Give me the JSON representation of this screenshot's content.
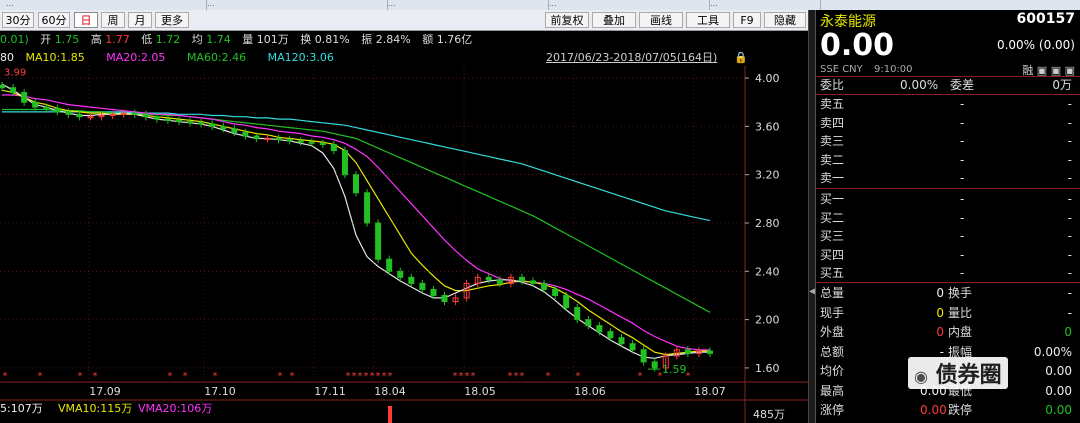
{
  "tabs": [
    "...",
    "...",
    "...",
    "...",
    "..."
  ],
  "toolbar": {
    "periods": [
      {
        "label": "30分",
        "active": false
      },
      {
        "label": "60分",
        "active": false
      },
      {
        "label": "日",
        "active": true
      },
      {
        "label": "周",
        "active": false
      },
      {
        "label": "月",
        "active": false
      },
      {
        "label": "更多",
        "active": false
      }
    ],
    "tools": [
      "前复权",
      "叠加",
      "画线",
      "工具",
      "F9",
      "隐藏"
    ]
  },
  "info": {
    "change": "0.01)",
    "open_label": "开",
    "open": "1.75",
    "high_label": "高",
    "high": "1.77",
    "low_label": "低",
    "low": "1.72",
    "avg_label": "均",
    "avg": "1.74",
    "volume_label": "量",
    "volume": "101万",
    "turnover_label": "换",
    "turnover": "0.81%",
    "amplitude_label": "振",
    "amplitude": "2.84%",
    "amount_label": "额",
    "amount": "1.76亿"
  },
  "ma": {
    "ma5": "80",
    "ma10": "MA10:1.85",
    "ma20": "MA20:2.05",
    "ma60": "MA60:2.46",
    "ma120": "MA120:3.06",
    "date_range": "2017/06/23-2018/07/05(164日)"
  },
  "chart_data": {
    "type": "candlestick",
    "y_ticks": [
      "4.00",
      "3.60",
      "3.20",
      "2.80",
      "2.40",
      "2.00",
      "1.60"
    ],
    "x_ticks": [
      "17.09",
      "17.10",
      "17.11",
      "18.04",
      "18.05",
      "18.06",
      "18.07"
    ],
    "annotations": [
      "3.99",
      "1.59"
    ],
    "closes": [
      3.92,
      3.88,
      3.8,
      3.76,
      3.75,
      3.72,
      3.7,
      3.68,
      3.68,
      3.69,
      3.7,
      3.71,
      3.7,
      3.68,
      3.66,
      3.65,
      3.64,
      3.63,
      3.62,
      3.6,
      3.58,
      3.55,
      3.52,
      3.5,
      3.5,
      3.49,
      3.48,
      3.47,
      3.46,
      3.45,
      3.4,
      3.2,
      3.05,
      2.8,
      2.5,
      2.4,
      2.35,
      2.3,
      2.25,
      2.2,
      2.15,
      2.18,
      2.3,
      2.35,
      2.33,
      2.3,
      2.35,
      2.32,
      2.3,
      2.25,
      2.2,
      2.1,
      2.0,
      1.95,
      1.9,
      1.85,
      1.8,
      1.75,
      1.65,
      1.6,
      1.7,
      1.75,
      1.72,
      1.74,
      1.72
    ],
    "ma10": [
      3.9,
      3.88,
      3.84,
      3.8,
      3.78,
      3.75,
      3.73,
      3.72,
      3.71,
      3.71,
      3.7,
      3.7,
      3.7,
      3.69,
      3.68,
      3.67,
      3.66,
      3.65,
      3.64,
      3.62,
      3.6,
      3.58,
      3.56,
      3.54,
      3.53,
      3.51,
      3.5,
      3.49,
      3.48,
      3.47,
      3.45,
      3.4,
      3.3,
      3.15,
      3.0,
      2.85,
      2.7,
      2.55,
      2.45,
      2.36,
      2.28,
      2.24,
      2.24,
      2.26,
      2.28,
      2.29,
      2.31,
      2.32,
      2.31,
      2.29,
      2.26,
      2.21,
      2.15,
      2.08,
      2.02,
      1.96,
      1.9,
      1.85,
      1.79,
      1.73,
      1.71,
      1.72,
      1.73,
      1.74,
      1.74
    ],
    "ma20": [
      3.86,
      3.86,
      3.85,
      3.83,
      3.82,
      3.8,
      3.78,
      3.77,
      3.76,
      3.75,
      3.74,
      3.73,
      3.72,
      3.71,
      3.7,
      3.7,
      3.69,
      3.68,
      3.67,
      3.66,
      3.64,
      3.62,
      3.61,
      3.59,
      3.58,
      3.56,
      3.55,
      3.54,
      3.52,
      3.51,
      3.49,
      3.46,
      3.41,
      3.35,
      3.26,
      3.16,
      3.06,
      2.96,
      2.86,
      2.76,
      2.66,
      2.57,
      2.49,
      2.42,
      2.38,
      2.34,
      2.32,
      2.32,
      2.31,
      2.3,
      2.28,
      2.25,
      2.21,
      2.17,
      2.12,
      2.07,
      2.02,
      1.97,
      1.91,
      1.86,
      1.82,
      1.78,
      1.76,
      1.75,
      1.75
    ],
    "ma60": [
      3.74,
      3.74,
      3.74,
      3.74,
      3.74,
      3.73,
      3.73,
      3.73,
      3.72,
      3.72,
      3.71,
      3.71,
      3.7,
      3.7,
      3.7,
      3.69,
      3.69,
      3.68,
      3.67,
      3.66,
      3.65,
      3.64,
      3.63,
      3.62,
      3.61,
      3.6,
      3.59,
      3.58,
      3.57,
      3.56,
      3.54,
      3.52,
      3.5,
      3.46,
      3.42,
      3.38,
      3.34,
      3.3,
      3.26,
      3.22,
      3.18,
      3.14,
      3.1,
      3.06,
      3.02,
      2.98,
      2.94,
      2.9,
      2.86,
      2.81,
      2.76,
      2.71,
      2.66,
      2.61,
      2.56,
      2.51,
      2.46,
      2.41,
      2.36,
      2.31,
      2.26,
      2.21,
      2.16,
      2.11,
      2.06
    ],
    "ma120": [
      3.72,
      3.72,
      3.72,
      3.72,
      3.72,
      3.72,
      3.72,
      3.72,
      3.72,
      3.72,
      3.72,
      3.72,
      3.71,
      3.71,
      3.71,
      3.71,
      3.7,
      3.7,
      3.7,
      3.69,
      3.69,
      3.68,
      3.68,
      3.67,
      3.67,
      3.66,
      3.66,
      3.65,
      3.64,
      3.63,
      3.62,
      3.61,
      3.59,
      3.57,
      3.55,
      3.53,
      3.51,
      3.49,
      3.47,
      3.45,
      3.43,
      3.41,
      3.39,
      3.37,
      3.35,
      3.33,
      3.31,
      3.29,
      3.26,
      3.23,
      3.2,
      3.17,
      3.14,
      3.11,
      3.08,
      3.05,
      3.02,
      2.99,
      2.96,
      2.93,
      2.9,
      2.88,
      2.86,
      2.84,
      2.82
    ],
    "ma5": [
      3.95,
      3.9,
      3.84,
      3.78,
      3.76,
      3.73,
      3.71,
      3.69,
      3.69,
      3.7,
      3.7,
      3.71,
      3.7,
      3.68,
      3.66,
      3.65,
      3.64,
      3.63,
      3.62,
      3.6,
      3.57,
      3.54,
      3.52,
      3.5,
      3.5,
      3.49,
      3.48,
      3.46,
      3.44,
      3.38,
      3.25,
      3.02,
      2.7,
      2.52,
      2.44,
      2.38,
      2.32,
      2.27,
      2.22,
      2.18,
      2.18,
      2.22,
      2.26,
      2.3,
      2.32,
      2.33,
      2.33,
      2.31,
      2.28,
      2.23,
      2.16,
      2.08,
      2.01,
      1.95,
      1.89,
      1.83,
      1.78,
      1.73,
      1.69,
      1.68,
      1.7,
      1.71,
      1.72,
      1.73,
      1.73
    ],
    "volume_ticks": [
      "485万"
    ],
    "volume_legend": [
      "5:107万",
      "VMA10:115万",
      "VMA20:106万"
    ]
  },
  "quote": {
    "name": "永泰能源",
    "code": "600157",
    "price": "0.00",
    "change_pct": "0.00%",
    "change_abs": "(0.00)",
    "exchange": "SSE",
    "currency": "CNY",
    "time": "9:10:00",
    "flags": [
      "融",
      "▣",
      "▣",
      "▣"
    ],
    "webi_label": "委比",
    "webi": "0.00%",
    "weicha_label": "委差",
    "weicha": "0万",
    "sells": [
      {
        "label": "卖五",
        "value": "-",
        "vol": "-"
      },
      {
        "label": "卖四",
        "value": "-",
        "vol": "-"
      },
      {
        "label": "卖三",
        "value": "-",
        "vol": "-"
      },
      {
        "label": "卖二",
        "value": "-",
        "vol": "-"
      },
      {
        "label": "卖一",
        "value": "-",
        "vol": "-"
      }
    ],
    "buys": [
      {
        "label": "买一",
        "value": "-",
        "vol": "-"
      },
      {
        "label": "买二",
        "value": "-",
        "vol": "-"
      },
      {
        "label": "买三",
        "value": "-",
        "vol": "-"
      },
      {
        "label": "买四",
        "value": "-",
        "vol": "-"
      },
      {
        "label": "买五",
        "value": "-",
        "vol": "-"
      }
    ],
    "stats": [
      {
        "l1": "总量",
        "v1": "0",
        "l2": "换手",
        "v2": "-"
      },
      {
        "l1": "现手",
        "v1": "0",
        "l2": "量比",
        "v2": "-"
      },
      {
        "l1": "外盘",
        "v1": "0",
        "l2": "内盘",
        "v2": "0"
      },
      {
        "l1": "总额",
        "v1": "-",
        "l2": "振幅",
        "v2": "0.00%"
      },
      {
        "l1": "均价",
        "v1": "-",
        "l2": "开盘",
        "v2": "0.00"
      },
      {
        "l1": "最高",
        "v1": "0.00",
        "l2": "最低",
        "v2": "0.00"
      },
      {
        "l1": "涨停",
        "v1": "0.00",
        "l2": "跌停",
        "v2": "0.00"
      }
    ],
    "watermark": "债券圈"
  },
  "colors": {
    "up": "#ff3b3b",
    "down": "#22c022",
    "ma5": "#e6e6e6",
    "ma10": "#e8e800",
    "ma20": "#ff33ff",
    "ma60": "#22c022",
    "ma120": "#33dddd",
    "grid": "#8a2020"
  }
}
